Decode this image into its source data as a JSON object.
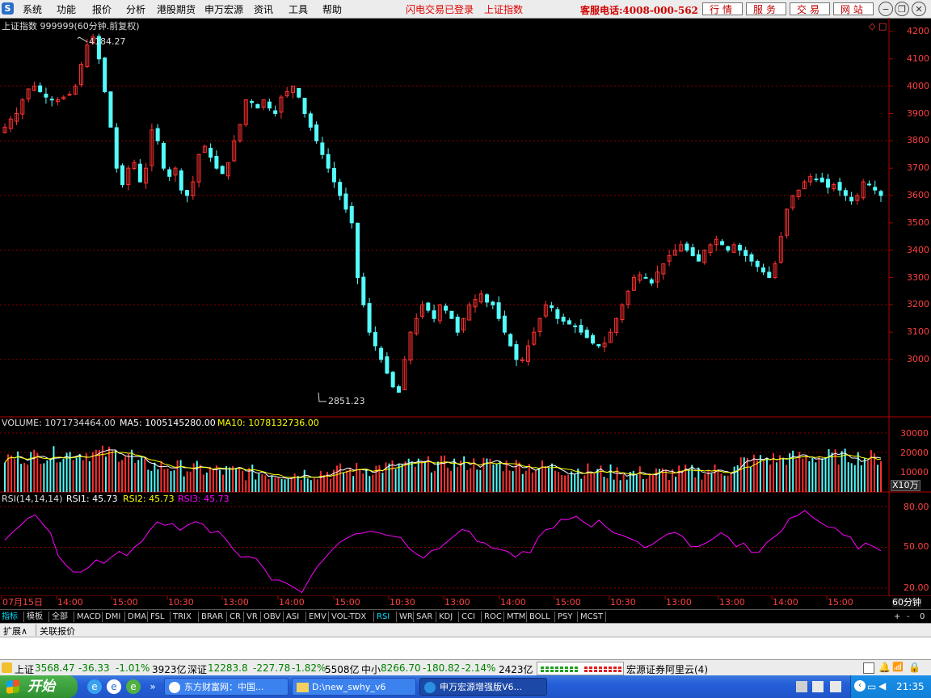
{
  "menu": {
    "items": [
      "系统",
      "功能",
      "报价",
      "分析",
      "港股期货",
      "申万宏源",
      "资讯",
      "工具",
      "帮助"
    ],
    "status1": "闪电交易已登录",
    "status2": "上证指数",
    "hotline": "客服电话:4008-000-562",
    "buttons": [
      "行情",
      "服务",
      "交易",
      "网站"
    ]
  },
  "price_panel": {
    "title": "上证指数 999999(60分钟.前复权)",
    "high_label": "4184.27",
    "low_label": "2851.23",
    "axis": [
      "4200",
      "4100",
      "4000",
      "3900",
      "3800",
      "3700",
      "3600",
      "3500",
      "3400",
      "3300",
      "3200",
      "3100",
      "3000"
    ]
  },
  "volume_panel": {
    "prefix": "VOLUME: 1071734464.00",
    "ma5": "MA5: 1005145280.00",
    "ma10": "MA10: 1078132736.00",
    "axis": [
      "30000",
      "20000",
      "10000"
    ],
    "unit": "X10万"
  },
  "rsi_panel": {
    "prefix": "RSI(14,14,14)",
    "rsi1": "RSI1: 45.73",
    "rsi2": "RSI2: 45.73",
    "rsi3": "RSI3: 45.73",
    "axis": [
      "80.00",
      "50.00",
      "20.00"
    ]
  },
  "time_axis": {
    "labels": [
      "07月15日",
      "14:00",
      "15:00",
      "10:30",
      "13:00",
      "14:00",
      "15:00",
      "10:30",
      "13:00",
      "14:00",
      "15:00",
      "10:30",
      "13:00",
      "13:00",
      "14:00",
      "15:00"
    ],
    "period": "60分钟"
  },
  "tabs": {
    "left": [
      "指标",
      "模板",
      "全部"
    ],
    "indicators": [
      "MACD",
      "DMI",
      "DMA",
      "FSL",
      "TRIX",
      "BRAR",
      "CR",
      "VR",
      "OBV",
      "ASI",
      "EMV",
      "VOL-TDX",
      "RSI",
      "WR",
      "SAR",
      "KDJ",
      "CCI",
      "ROC",
      "MTM",
      "BOLL",
      "PSY",
      "MCST"
    ],
    "active": "RSI",
    "right": [
      "+",
      "-",
      "0"
    ]
  },
  "subtabs": [
    "扩展∧",
    "关联报价"
  ],
  "index_bar": {
    "sh_name": "上证",
    "sh_value": "3568.47",
    "sh_change": "-36.33",
    "sh_pct": "-1.01%",
    "sh_amount": "3923亿",
    "sz_name": "深证",
    "sz_value": "12283.8",
    "sz_change": "-227.78",
    "sz_pct": "-1.82%",
    "sz_amount": "5508亿",
    "zx_name": "中小",
    "zx_value": "8266.70",
    "zx_change": "-180.82",
    "zx_pct": "-2.14%",
    "zx_amount": "2423亿",
    "server": "宏源证券阿里云(4)"
  },
  "taskbar": {
    "start": "开始",
    "tasks": [
      "东方财富网：中国...",
      "D:\\new_swhy_v6",
      "申万宏源增强版V6..."
    ],
    "clock": "21:35"
  },
  "colors": {
    "up": "#ff3232",
    "down": "#54fcfc",
    "grid": "#8b0000",
    "ma5": "#ffffff",
    "ma10": "#ffff00",
    "rsi": "#ff00ff"
  },
  "chart_data": [
    {
      "type": "candlestick",
      "title": "上证指数 999999(60分钟.前复权)",
      "ylim": [
        2850,
        4200
      ],
      "annotations": [
        "4184.27",
        "2851.23"
      ],
      "close_path": [
        3850,
        3880,
        3900,
        3950,
        3990,
        4000,
        3980,
        3960,
        3950,
        3950,
        3960,
        3970,
        4000,
        4080,
        4150,
        4180,
        4100,
        3980,
        3850,
        3700,
        3640,
        3700,
        3720,
        3650,
        3700,
        3840,
        3800,
        3700,
        3670,
        3700,
        3620,
        3600,
        3650,
        3750,
        3780,
        3740,
        3700,
        3680,
        3720,
        3800,
        3860,
        3950,
        3940,
        3920,
        3950,
        3920,
        3900,
        3960,
        3980,
        4000,
        3960,
        3900,
        3850,
        3800,
        3750,
        3700,
        3650,
        3600,
        3550,
        3500,
        3300,
        3200,
        3100,
        3050,
        3000,
        2950,
        2900,
        2880,
        3000,
        3100,
        3150,
        3200,
        3180,
        3150,
        3200,
        3180,
        3150,
        3100,
        3150,
        3200,
        3220,
        3240,
        3210,
        3200,
        3150,
        3100,
        3050,
        3000,
        3000,
        3050,
        3100,
        3150,
        3200,
        3190,
        3150,
        3140,
        3130,
        3120,
        3100,
        3080,
        3060,
        3050,
        3060,
        3100,
        3150,
        3200,
        3250,
        3300,
        3310,
        3300,
        3280,
        3320,
        3350,
        3380,
        3400,
        3420,
        3400,
        3380,
        3360,
        3400,
        3420,
        3440,
        3420,
        3400,
        3420,
        3400,
        3380,
        3360,
        3340,
        3320,
        3300,
        3350,
        3450,
        3550,
        3600,
        3620,
        3650,
        3670,
        3660,
        3650,
        3630,
        3640,
        3620,
        3600,
        3580,
        3600,
        3650,
        3640,
        3620,
        3600
      ]
    },
    {
      "type": "bar",
      "title": "VOLUME",
      "ylim": [
        0,
        35000
      ],
      "unit": "X10万"
    },
    {
      "type": "line",
      "title": "RSI(14,14,14)",
      "ylim": [
        15,
        85
      ],
      "series": [
        {
          "name": "RSI3",
          "values": [
            55,
            60,
            65,
            70,
            72,
            68,
            60,
            45,
            35,
            32,
            30,
            36,
            40,
            38,
            42,
            46,
            44,
            50,
            56,
            64,
            70,
            68,
            66,
            64,
            68,
            70,
            66,
            60,
            62,
            56,
            50,
            44,
            42,
            40,
            34,
            28,
            26,
            24,
            20,
            18,
            26,
            34,
            42,
            50,
            54,
            56,
            58,
            60,
            62,
            60,
            58,
            60,
            56,
            50,
            44,
            42,
            46,
            50,
            54,
            58,
            62,
            60,
            56,
            52,
            50,
            48,
            46,
            44,
            46,
            48,
            56,
            62,
            66,
            70,
            72,
            74,
            70,
            66,
            68,
            64,
            60,
            58,
            56,
            54,
            48,
            52,
            56,
            58,
            60,
            56,
            52,
            50,
            54,
            58,
            60,
            56,
            52,
            54,
            48,
            46,
            52,
            58,
            64,
            70,
            74,
            76,
            72,
            70,
            66,
            64,
            60,
            56,
            50,
            54,
            52,
            46
          ]
        }
      ]
    }
  ]
}
